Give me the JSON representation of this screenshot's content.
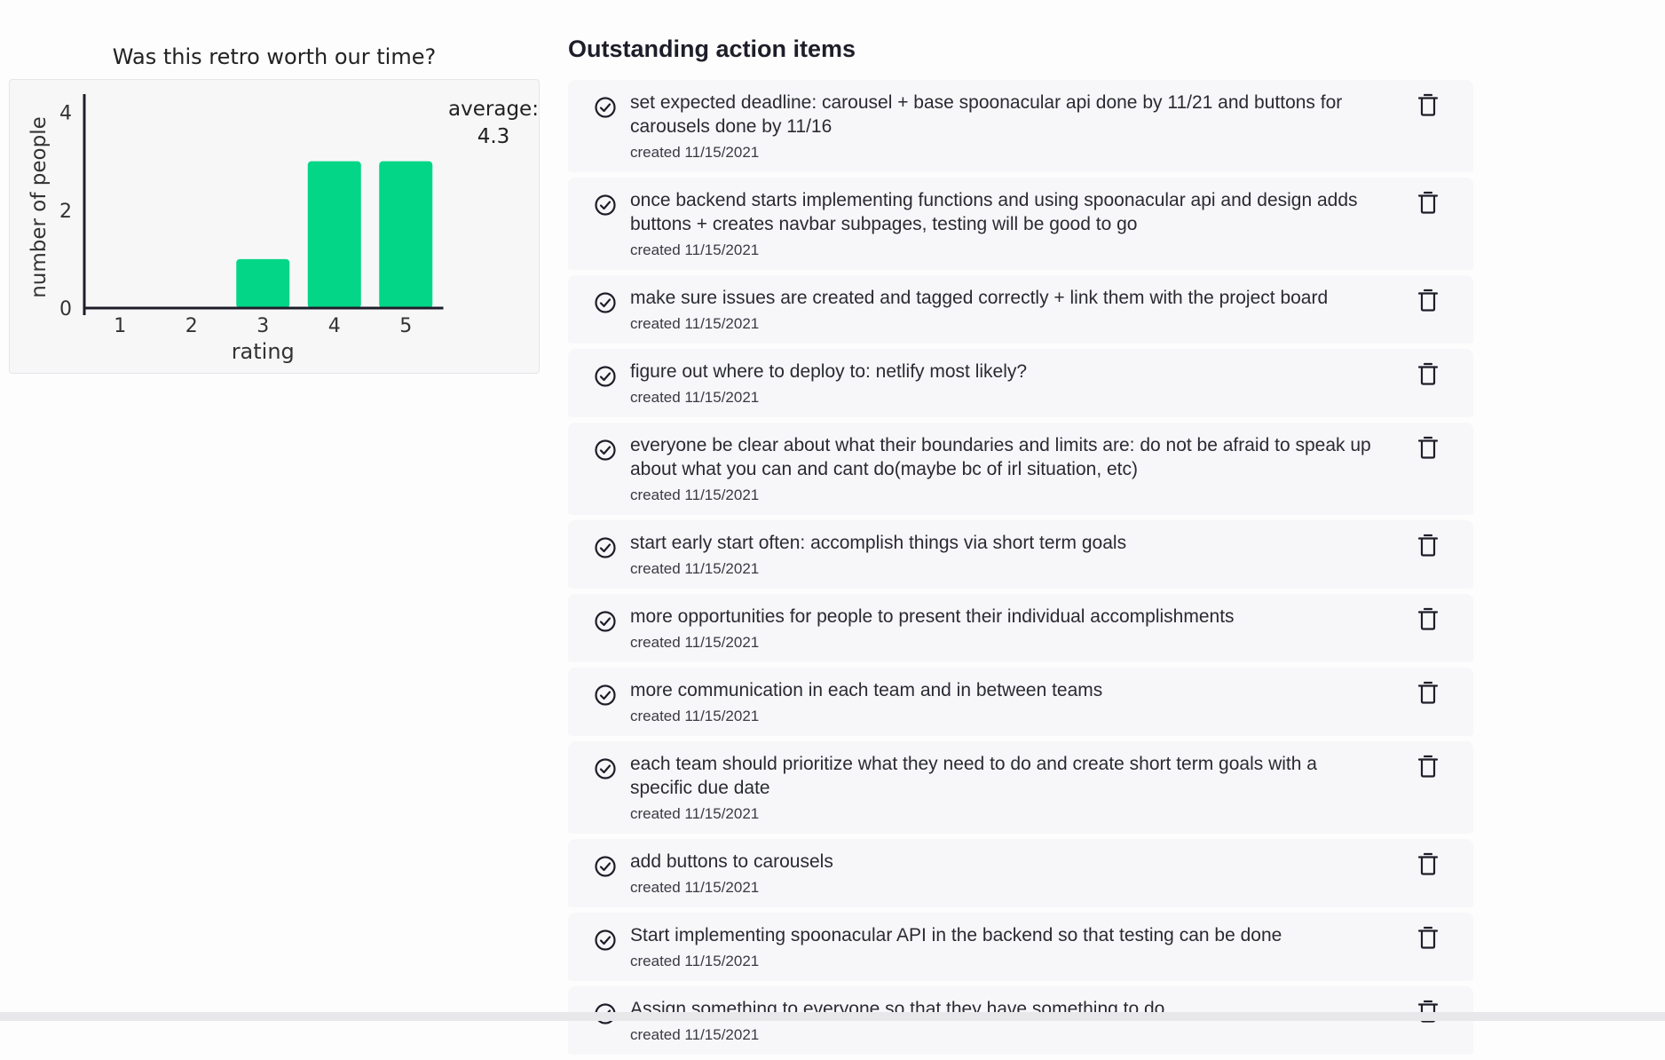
{
  "chart": {
    "title": "Was this retro worth our time?",
    "average_label": "average:",
    "average_value": "4.3"
  },
  "chart_data": {
    "type": "bar",
    "categories": [
      "1",
      "2",
      "3",
      "4",
      "5"
    ],
    "values": [
      0,
      0,
      1,
      3,
      3
    ],
    "xlabel": "rating",
    "ylabel": "number of people",
    "ylim": [
      0,
      4.3
    ],
    "yticks": [
      0,
      2,
      4
    ],
    "bar_color": "#03d687",
    "axis_color": "#1e1e2a"
  },
  "actions": {
    "title": "Outstanding action items",
    "items": [
      {
        "text": "set expected deadline: carousel + base spoonacular api done by 11/21 and buttons for carousels done by 11/16",
        "date": "created 11/15/2021"
      },
      {
        "text": "once backend starts implementing functions and using spoonacular api and design adds buttons + creates navbar subpages, testing will be good to go",
        "date": "created 11/15/2021"
      },
      {
        "text": "make sure issues are created and tagged correctly + link them with the project board",
        "date": "created 11/15/2021"
      },
      {
        "text": "figure out where to deploy to: netlify most likely?",
        "date": "created 11/15/2021"
      },
      {
        "text": "everyone be clear about what their boundaries and limits are: do not be afraid to speak up about what you can and cant do(maybe bc of irl situation, etc)",
        "date": "created 11/15/2021"
      },
      {
        "text": "start early start often: accomplish things via short term goals",
        "date": "created 11/15/2021"
      },
      {
        "text": "more opportunities for people to present their individual accomplishments",
        "date": "created 11/15/2021"
      },
      {
        "text": "more communication in each team and in between teams",
        "date": "created 11/15/2021"
      },
      {
        "text": "each team should prioritize what they need to do and create short term goals with a specific due date",
        "date": "created 11/15/2021"
      },
      {
        "text": "add buttons to carousels",
        "date": "created 11/15/2021"
      },
      {
        "text": "Start implementing spoonacular API in the backend so that testing can be done",
        "date": "created 11/15/2021"
      },
      {
        "text": "Assign something to everyone so that they have something to do",
        "date": "created 11/15/2021"
      }
    ]
  }
}
